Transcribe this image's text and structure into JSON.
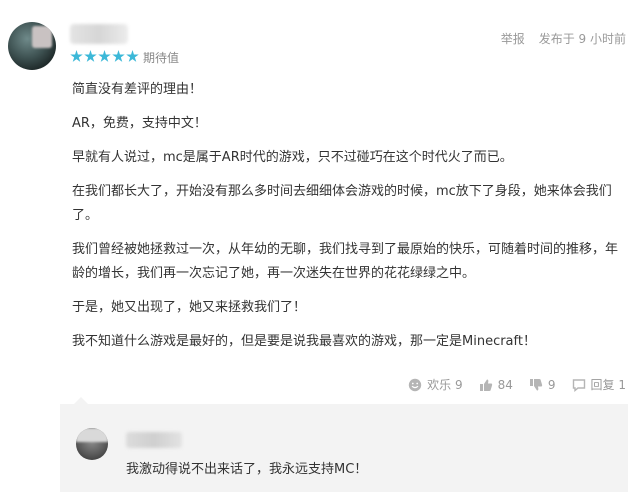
{
  "review": {
    "rating_label": "期待值",
    "stars": 5,
    "meta": {
      "report_label": "举报",
      "posted_label": "发布于 9 小时前"
    },
    "paragraphs": [
      "简直没有差评的理由！",
      "AR，免费，支持中文！",
      "早就有人说过，mc是属于AR时代的游戏，只不过碰巧在这个时代火了而已。",
      "在我们都长大了，开始没有那么多时间去细细体会游戏的时候，mc放下了身段，她来体会我们了。",
      "我们曾经被她拯救过一次，从年幼的无聊，我们找寻到了最原始的快乐，可随着时间的推移，年龄的增长，我们再一次忘记了她，再一次迷失在世界的花花绿绿之中。",
      "于是，她又出现了，她又来拯救我们了！",
      "我不知道什么游戏是最好的，但是要是说我最喜欢的游戏，那一定是Minecraft！"
    ],
    "actions": {
      "funny": "欢乐 9",
      "like": "84",
      "dislike": "9",
      "reply": "回复 1"
    },
    "star_color": "#3cb8d8"
  },
  "reply": {
    "text": "我激动得说不出来话了，我永远支持MC！"
  }
}
